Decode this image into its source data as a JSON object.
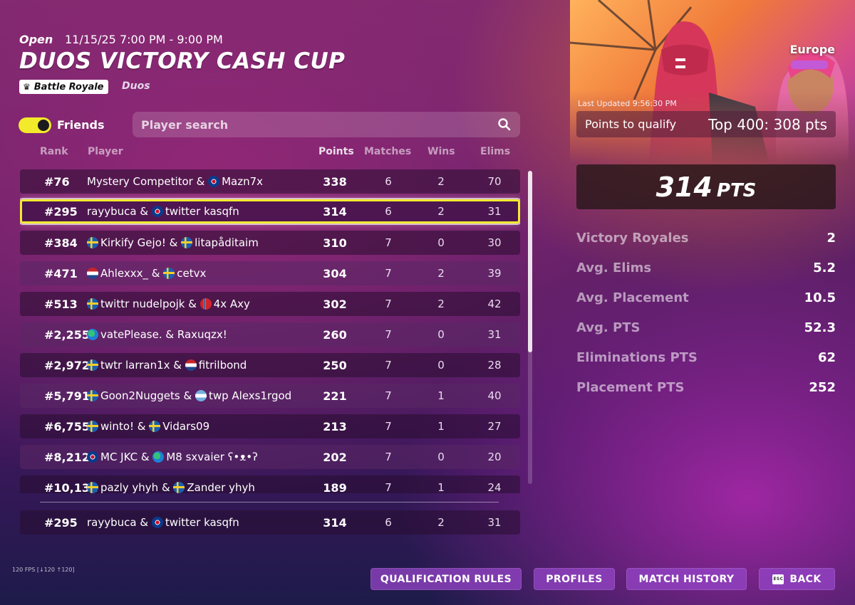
{
  "event": {
    "status": "Open",
    "time": "11/15/25 7:00 PM - 9:00 PM",
    "title": "DUOS VICTORY CASH CUP",
    "mode": "Battle Royale",
    "team_size": "Duos",
    "region": "Europe"
  },
  "filters": {
    "friends_label": "Friends",
    "friends_on": true,
    "search_placeholder": "Player search"
  },
  "columns": {
    "rank": "Rank",
    "player": "Player",
    "points": "Points",
    "matches": "Matches",
    "wins": "Wins",
    "elims": "Elims"
  },
  "leaderboard": [
    {
      "rank": "#76",
      "p1": "Mystery Competitor",
      "f2": "gb",
      "p2": "Mazn7x",
      "points": "338",
      "matches": "6",
      "wins": "2",
      "elims": "70"
    },
    {
      "rank": "#295",
      "p1": "rayybuca",
      "f2": "gb",
      "p2": "twitter kasqfn",
      "points": "314",
      "matches": "6",
      "wins": "2",
      "elims": "31"
    },
    {
      "rank": "#384",
      "f1": "se",
      "p1": "Kirkify Gejo!",
      "f2": "se",
      "p2": "litapåditaim",
      "points": "310",
      "matches": "7",
      "wins": "0",
      "elims": "30"
    },
    {
      "rank": "#471",
      "f1": "nl",
      "p1": "Ahlexxx_",
      "f2": "se",
      "p2": "cetvx",
      "points": "304",
      "matches": "7",
      "wins": "2",
      "elims": "39"
    },
    {
      "rank": "#513",
      "f1": "se",
      "p1": "twittr nudelpojk",
      "f2": "no",
      "p2": "4x Axy",
      "points": "302",
      "matches": "7",
      "wins": "2",
      "elims": "42"
    },
    {
      "rank": "#2,255",
      "f1": "world",
      "p1": "vatePlease. & Raxuqzx!",
      "points": "260",
      "matches": "7",
      "wins": "0",
      "elims": "31"
    },
    {
      "rank": "#2,972",
      "f1": "se",
      "p1": "twtr larran1x",
      "f2": "nl",
      "p2": "fitrilbond",
      "points": "250",
      "matches": "7",
      "wins": "0",
      "elims": "28"
    },
    {
      "rank": "#5,791",
      "f1": "se",
      "p1": "Goon2Nuggets",
      "f2": "ar",
      "p2": "twp Alexs1rgod",
      "points": "221",
      "matches": "7",
      "wins": "1",
      "elims": "40"
    },
    {
      "rank": "#6,755",
      "f1": "se",
      "p1": "winto!",
      "f2": "se",
      "p2": "Vidars09",
      "points": "213",
      "matches": "7",
      "wins": "1",
      "elims": "27"
    },
    {
      "rank": "#8,212",
      "f1": "gb",
      "p1": "MC JKC",
      "f2": "world",
      "p2": "M8 sxvaier ʕ•ᴥ•ʔ",
      "points": "202",
      "matches": "7",
      "wins": "0",
      "elims": "20"
    },
    {
      "rank": "#10,131",
      "f1": "se",
      "p1": "pazly yhyh",
      "f2": "se",
      "p2": "Zander yhyh",
      "points": "189",
      "matches": "7",
      "wins": "1",
      "elims": "24"
    }
  ],
  "pinned_row": {
    "rank": "#295",
    "p1": "rayybuca",
    "f2": "gb",
    "p2": "twitter kasqfn",
    "points": "314",
    "matches": "6",
    "wins": "2",
    "elims": "31"
  },
  "summary": {
    "last_updated": "Last Updated 9:56:30 PM",
    "qualify_label": "Points to qualify",
    "qualify_value": "Top 400: 308 pts",
    "points_value": "314",
    "points_unit": "PTS",
    "stats": [
      {
        "label": "Victory Royales",
        "value": "2"
      },
      {
        "label": "Avg. Elims",
        "value": "5.2"
      },
      {
        "label": "Avg. Placement",
        "value": "10.5"
      },
      {
        "label": "Avg. PTS",
        "value": "52.3"
      },
      {
        "label": "Eliminations PTS",
        "value": "62"
      },
      {
        "label": "Placement PTS",
        "value": "252"
      }
    ]
  },
  "footer": {
    "fps": "120 FPS [↓120 ↑120]",
    "buttons": {
      "qualification_rules": "QUALIFICATION RULES",
      "profiles": "PROFILES",
      "match_history": "MATCH HISTORY",
      "back": "BACK",
      "back_key": "ESC"
    }
  },
  "colors": {
    "highlight": "#f2ea2f",
    "toggle_on": "#f3ea2b",
    "button": "#9646c8"
  }
}
